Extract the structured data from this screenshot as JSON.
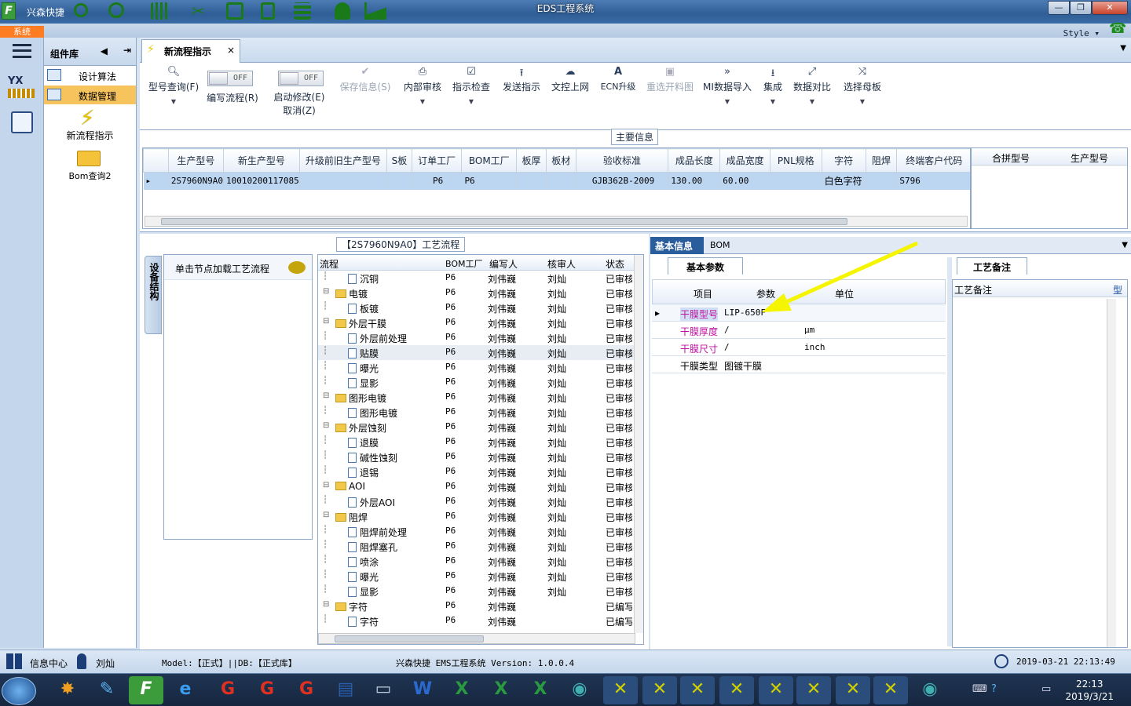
{
  "window": {
    "app_name": "兴森快捷",
    "title": "EDS工程系统",
    "minimize": "—",
    "restore": "❐",
    "close": "✕"
  },
  "menu": {
    "system_tab": "系统",
    "style_label": "Style"
  },
  "component_library": {
    "title": "组件库",
    "items": [
      {
        "label": "设计算法"
      },
      {
        "label": "数据管理",
        "selected": true
      },
      {
        "label": "新流程指示"
      },
      {
        "label": "Bom查询2"
      }
    ]
  },
  "doc_tab": {
    "label": "新流程指示",
    "close": "×"
  },
  "toolbar": {
    "buttons": [
      {
        "label": "型号查询(F)",
        "icon": "search-icon"
      },
      {
        "label": "编写流程(R)",
        "toggle": "OFF"
      },
      {
        "label": "启动修改(E)",
        "label2": "取消(Z)",
        "toggle": "OFF"
      },
      {
        "label": "保存信息(S)",
        "icon": "check-icon",
        "disabled": true
      },
      {
        "label": "内部审核",
        "icon": "printer-icon"
      },
      {
        "label": "指示检查",
        "icon": "checkbox-icon"
      },
      {
        "label": "发送指示",
        "icon": "upload-icon"
      },
      {
        "label": "文控上网",
        "icon": "cloud-upload-icon"
      },
      {
        "label": "ECN升级",
        "icon": "ecn-icon"
      },
      {
        "label": "重选开料图",
        "icon": "image-icon",
        "disabled": true
      },
      {
        "label": "MI数据导入",
        "icon": "chevrons-icon"
      },
      {
        "label": "集成",
        "icon": "download-icon"
      },
      {
        "label": "数据对比",
        "icon": "compare-icon"
      },
      {
        "label": "选择母板",
        "icon": "shuffle-icon"
      }
    ]
  },
  "main_info": {
    "section_title": "主要信息",
    "columns": [
      "生产型号",
      "新生产型号",
      "升级前旧生产型号",
      "S板",
      "订单工厂",
      "BOM工厂",
      "板厚",
      "板材",
      "验收标准",
      "成品长度",
      "成品宽度",
      "PNL规格",
      "字符",
      "阻焊",
      "终端客户代码"
    ],
    "rows": [
      [
        "2S7960N9A0",
        "10010200117085",
        "",
        "",
        "P6",
        "P6",
        "",
        "",
        "GJB362B-2009",
        "130.00",
        "60.00",
        "",
        "白色字符",
        "",
        "S796"
      ]
    ],
    "side_columns": [
      "合拼型号",
      "生产型号"
    ]
  },
  "process_panel": {
    "title": "【2S7960N9A0】工艺流程",
    "vertical_tab": "设备结构",
    "hint": "单击节点加载工艺流程",
    "columns": [
      "流程",
      "BOM工厂",
      "编写人",
      "核审人",
      "状态"
    ],
    "rows": [
      {
        "level": 2,
        "name": "沉铜",
        "bom": "P6",
        "writer": "刘伟巍",
        "reviewer": "刘灿",
        "status": "已审核"
      },
      {
        "level": 1,
        "name": "电镀",
        "bom": "P6",
        "writer": "刘伟巍",
        "reviewer": "刘灿",
        "status": "已审核"
      },
      {
        "level": 2,
        "name": "板镀",
        "bom": "P6",
        "writer": "刘伟巍",
        "reviewer": "刘灿",
        "status": "已审核"
      },
      {
        "level": 1,
        "name": "外层干膜",
        "bom": "P6",
        "writer": "刘伟巍",
        "reviewer": "刘灿",
        "status": "已审核"
      },
      {
        "level": 2,
        "name": "外层前处理",
        "bom": "P6",
        "writer": "刘伟巍",
        "reviewer": "刘灿",
        "status": "已审核"
      },
      {
        "level": 2,
        "name": "贴膜",
        "bom": "P6",
        "writer": "刘伟巍",
        "reviewer": "刘灿",
        "status": "已审核",
        "selected": true
      },
      {
        "level": 2,
        "name": "曝光",
        "bom": "P6",
        "writer": "刘伟巍",
        "reviewer": "刘灿",
        "status": "已审核"
      },
      {
        "level": 2,
        "name": "显影",
        "bom": "P6",
        "writer": "刘伟巍",
        "reviewer": "刘灿",
        "status": "已审核"
      },
      {
        "level": 1,
        "name": "图形电镀",
        "bom": "P6",
        "writer": "刘伟巍",
        "reviewer": "刘灿",
        "status": "已审核"
      },
      {
        "level": 2,
        "name": "图形电镀",
        "bom": "P6",
        "writer": "刘伟巍",
        "reviewer": "刘灿",
        "status": "已审核"
      },
      {
        "level": 1,
        "name": "外层蚀刻",
        "bom": "P6",
        "writer": "刘伟巍",
        "reviewer": "刘灿",
        "status": "已审核"
      },
      {
        "level": 2,
        "name": "退膜",
        "bom": "P6",
        "writer": "刘伟巍",
        "reviewer": "刘灿",
        "status": "已审核"
      },
      {
        "level": 2,
        "name": "碱性蚀刻",
        "bom": "P6",
        "writer": "刘伟巍",
        "reviewer": "刘灿",
        "status": "已审核"
      },
      {
        "level": 2,
        "name": "退锡",
        "bom": "P6",
        "writer": "刘伟巍",
        "reviewer": "刘灿",
        "status": "已审核"
      },
      {
        "level": 1,
        "name": "AOI",
        "bom": "P6",
        "writer": "刘伟巍",
        "reviewer": "刘灿",
        "status": "已审核"
      },
      {
        "level": 2,
        "name": "外层AOI",
        "bom": "P6",
        "writer": "刘伟巍",
        "reviewer": "刘灿",
        "status": "已审核"
      },
      {
        "level": 1,
        "name": "阻焊",
        "bom": "P6",
        "writer": "刘伟巍",
        "reviewer": "刘灿",
        "status": "已审核"
      },
      {
        "level": 2,
        "name": "阻焊前处理",
        "bom": "P6",
        "writer": "刘伟巍",
        "reviewer": "刘灿",
        "status": "已审核"
      },
      {
        "level": 2,
        "name": "阻焊塞孔",
        "bom": "P6",
        "writer": "刘伟巍",
        "reviewer": "刘灿",
        "status": "已审核"
      },
      {
        "level": 2,
        "name": "喷涂",
        "bom": "P6",
        "writer": "刘伟巍",
        "reviewer": "刘灿",
        "status": "已审核"
      },
      {
        "level": 2,
        "name": "曝光",
        "bom": "P6",
        "writer": "刘伟巍",
        "reviewer": "刘灿",
        "status": "已审核"
      },
      {
        "level": 2,
        "name": "显影",
        "bom": "P6",
        "writer": "刘伟巍",
        "reviewer": "刘灿",
        "status": "已审核"
      },
      {
        "level": 1,
        "name": "字符",
        "bom": "P6",
        "writer": "刘伟巍",
        "reviewer": "",
        "status": "已编写"
      },
      {
        "level": 2,
        "name": "字符",
        "bom": "P6",
        "writer": "刘伟巍",
        "reviewer": "",
        "status": "已编写"
      }
    ]
  },
  "right_panel": {
    "tabs": [
      "基本信息",
      "BOM"
    ],
    "subtab": "基本参数",
    "param_columns": [
      "项目",
      "参数",
      "单位"
    ],
    "params": [
      {
        "key": "干膜型号",
        "value": "LIP-650F",
        "unit": "",
        "highlight": true
      },
      {
        "key": "干膜厚度",
        "value": "/",
        "unit": "μm",
        "highlight": true
      },
      {
        "key": "干膜尺寸",
        "value": "/",
        "unit": "inch",
        "highlight": true
      },
      {
        "key": "干膜类型",
        "value": "图镀干膜",
        "unit": "",
        "highlight": false
      }
    ],
    "notes_tab": "工艺备注",
    "notes_columns": [
      "工艺备注",
      "型"
    ],
    "arrow_color": "#f5f500"
  },
  "status_bar": {
    "info_center": "信息中心",
    "user": "刘灿",
    "model": "Model:【正式】||DB:【正式库】",
    "version": "兴森快捷 EMS工程系统 Version: 1.0.0.4",
    "datetime": "2019-03-21 22:13:49"
  },
  "taskbar": {
    "time": "22:13",
    "date": "2019/3/21"
  }
}
